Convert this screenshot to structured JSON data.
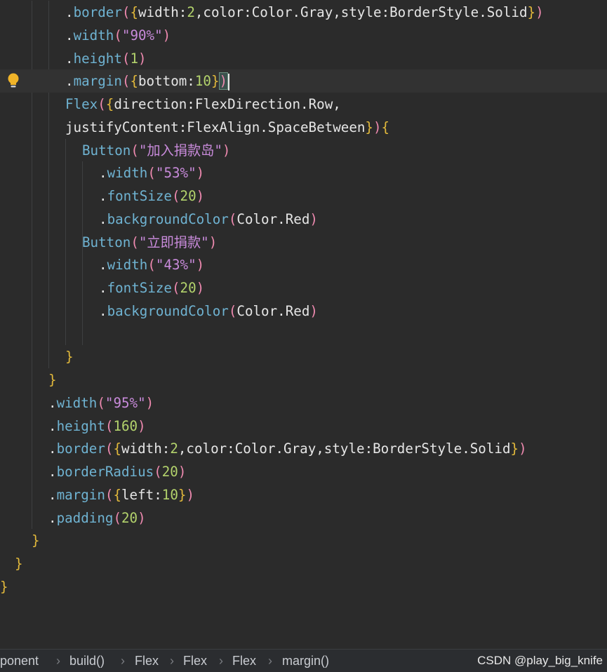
{
  "editor": {
    "lines": [
      [
        [
          ".",
          "plain"
        ],
        [
          "border",
          "method"
        ],
        [
          "(",
          "paren"
        ],
        [
          "{",
          "brace"
        ],
        [
          "width:",
          "plain"
        ],
        [
          "2",
          "num"
        ],
        [
          ",color:Color.Gray,style:BorderStyle.Solid",
          "plain"
        ],
        [
          "}",
          "brace"
        ],
        [
          ")",
          "paren"
        ]
      ],
      [
        [
          ".",
          "plain"
        ],
        [
          "width",
          "method"
        ],
        [
          "(",
          "paren"
        ],
        [
          "\"90%\"",
          "str"
        ],
        [
          ")",
          "paren"
        ]
      ],
      [
        [
          ".",
          "plain"
        ],
        [
          "height",
          "method"
        ],
        [
          "(",
          "paren"
        ],
        [
          "1",
          "num"
        ],
        [
          ")",
          "paren"
        ]
      ],
      [
        [
          ".",
          "plain"
        ],
        [
          "margin",
          "method"
        ],
        [
          "(",
          "paren"
        ],
        [
          "{",
          "brace"
        ],
        [
          "bottom:",
          "plain"
        ],
        [
          "10",
          "num"
        ],
        [
          "}",
          "brace"
        ],
        [
          ")",
          "match"
        ]
      ],
      [
        [
          "Flex",
          "method"
        ],
        [
          "(",
          "paren"
        ],
        [
          "{",
          "brace"
        ],
        [
          "direction:FlexDirection.Row,",
          "plain"
        ]
      ],
      [
        [
          "justifyContent:FlexAlign.SpaceBetween",
          "plain"
        ],
        [
          "}",
          "brace"
        ],
        [
          ")",
          "paren"
        ],
        [
          "{",
          "brace"
        ]
      ],
      [
        [
          "Button",
          "method"
        ],
        [
          "(",
          "paren"
        ],
        [
          "\"加入捐款岛\"",
          "str"
        ],
        [
          ")",
          "paren"
        ]
      ],
      [
        [
          ".",
          "plain"
        ],
        [
          "width",
          "method"
        ],
        [
          "(",
          "paren"
        ],
        [
          "\"53%\"",
          "str"
        ],
        [
          ")",
          "paren"
        ]
      ],
      [
        [
          ".",
          "plain"
        ],
        [
          "fontSize",
          "method"
        ],
        [
          "(",
          "paren"
        ],
        [
          "20",
          "num"
        ],
        [
          ")",
          "paren"
        ]
      ],
      [
        [
          ".",
          "plain"
        ],
        [
          "backgroundColor",
          "method"
        ],
        [
          "(",
          "paren"
        ],
        [
          "Color.Red",
          "plain"
        ],
        [
          ")",
          "paren"
        ]
      ],
      [
        [
          "Button",
          "method"
        ],
        [
          "(",
          "paren"
        ],
        [
          "\"立即捐款\"",
          "str"
        ],
        [
          ")",
          "paren"
        ]
      ],
      [
        [
          ".",
          "plain"
        ],
        [
          "width",
          "method"
        ],
        [
          "(",
          "paren"
        ],
        [
          "\"43%\"",
          "str"
        ],
        [
          ")",
          "paren"
        ]
      ],
      [
        [
          ".",
          "plain"
        ],
        [
          "fontSize",
          "method"
        ],
        [
          "(",
          "paren"
        ],
        [
          "20",
          "num"
        ],
        [
          ")",
          "paren"
        ]
      ],
      [
        [
          ".",
          "plain"
        ],
        [
          "backgroundColor",
          "method"
        ],
        [
          "(",
          "paren"
        ],
        [
          "Color.Red",
          "plain"
        ],
        [
          ")",
          "paren"
        ]
      ],
      [],
      [
        [
          "}",
          "brace"
        ]
      ],
      [
        [
          "}",
          "brace"
        ]
      ],
      [
        [
          ".",
          "plain"
        ],
        [
          "width",
          "method"
        ],
        [
          "(",
          "paren"
        ],
        [
          "\"95%\"",
          "str"
        ],
        [
          ")",
          "paren"
        ]
      ],
      [
        [
          ".",
          "plain"
        ],
        [
          "height",
          "method"
        ],
        [
          "(",
          "paren"
        ],
        [
          "160",
          "num"
        ],
        [
          ")",
          "paren"
        ]
      ],
      [
        [
          ".",
          "plain"
        ],
        [
          "border",
          "method"
        ],
        [
          "(",
          "paren"
        ],
        [
          "{",
          "brace"
        ],
        [
          "width:",
          "plain"
        ],
        [
          "2",
          "num"
        ],
        [
          ",color:Color.Gray,style:BorderStyle.Solid",
          "plain"
        ],
        [
          "}",
          "brace"
        ],
        [
          ")",
          "paren"
        ]
      ],
      [
        [
          ".",
          "plain"
        ],
        [
          "borderRadius",
          "method"
        ],
        [
          "(",
          "paren"
        ],
        [
          "20",
          "num"
        ],
        [
          ")",
          "paren"
        ]
      ],
      [
        [
          ".",
          "plain"
        ],
        [
          "margin",
          "method"
        ],
        [
          "(",
          "paren"
        ],
        [
          "{",
          "brace"
        ],
        [
          "left:",
          "plain"
        ],
        [
          "10",
          "num"
        ],
        [
          "}",
          "brace"
        ],
        [
          ")",
          "paren"
        ]
      ],
      [
        [
          ".",
          "plain"
        ],
        [
          "padding",
          "method"
        ],
        [
          "(",
          "paren"
        ],
        [
          "20",
          "num"
        ],
        [
          ")",
          "paren"
        ]
      ],
      [
        [
          "}",
          "brace"
        ]
      ],
      [
        [
          "}",
          "brace"
        ]
      ],
      [
        [
          "}",
          "brace"
        ]
      ]
    ]
  },
  "breadcrumbs": [
    "ponent",
    "build()",
    "Flex",
    "Flex",
    "Flex",
    "margin()"
  ],
  "watermark": "CSDN @play_big_knife",
  "icons": {
    "gutter": "lightbulb-icon"
  },
  "colors": {
    "background": "#2b2b2b",
    "method": "#6fb3d2",
    "string": "#c98bdb",
    "number": "#b3d36c",
    "brace": "#e2b93b",
    "paren": "#ef8ab0"
  }
}
